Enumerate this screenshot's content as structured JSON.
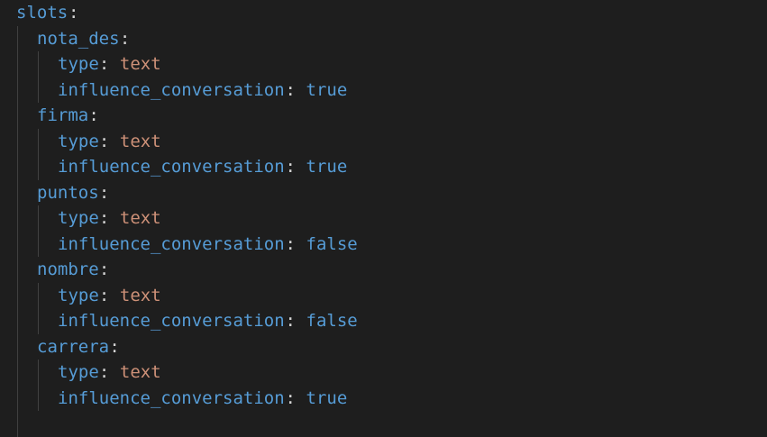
{
  "root": {
    "key": "slots",
    "colon": ":"
  },
  "slots": [
    {
      "name": "nota_des",
      "colon": ":",
      "type_key": "type",
      "type_colon": ":",
      "type_value": "text",
      "influence_key": "influence_conversation",
      "influence_colon": ":",
      "influence_value": "true"
    },
    {
      "name": "firma",
      "colon": ":",
      "type_key": "type",
      "type_colon": ":",
      "type_value": "text",
      "influence_key": "influence_conversation",
      "influence_colon": ":",
      "influence_value": "true"
    },
    {
      "name": "puntos",
      "colon": ":",
      "type_key": "type",
      "type_colon": ":",
      "type_value": "text",
      "influence_key": "influence_conversation",
      "influence_colon": ":",
      "influence_value": "false"
    },
    {
      "name": "nombre",
      "colon": ":",
      "type_key": "type",
      "type_colon": ":",
      "type_value": "text",
      "influence_key": "influence_conversation",
      "influence_colon": ":",
      "influence_value": "false"
    },
    {
      "name": "carrera",
      "colon": ":",
      "type_key": "type",
      "type_colon": ":",
      "type_value": "text",
      "influence_key": "influence_conversation",
      "influence_colon": ":",
      "influence_value": "true"
    }
  ],
  "colors": {
    "background": "#1e1e1e",
    "key": "#569cd6",
    "string": "#ce9178",
    "boolean": "#569cd6",
    "punctuation": "#d4d4d4",
    "indent_guide": "#404040"
  }
}
